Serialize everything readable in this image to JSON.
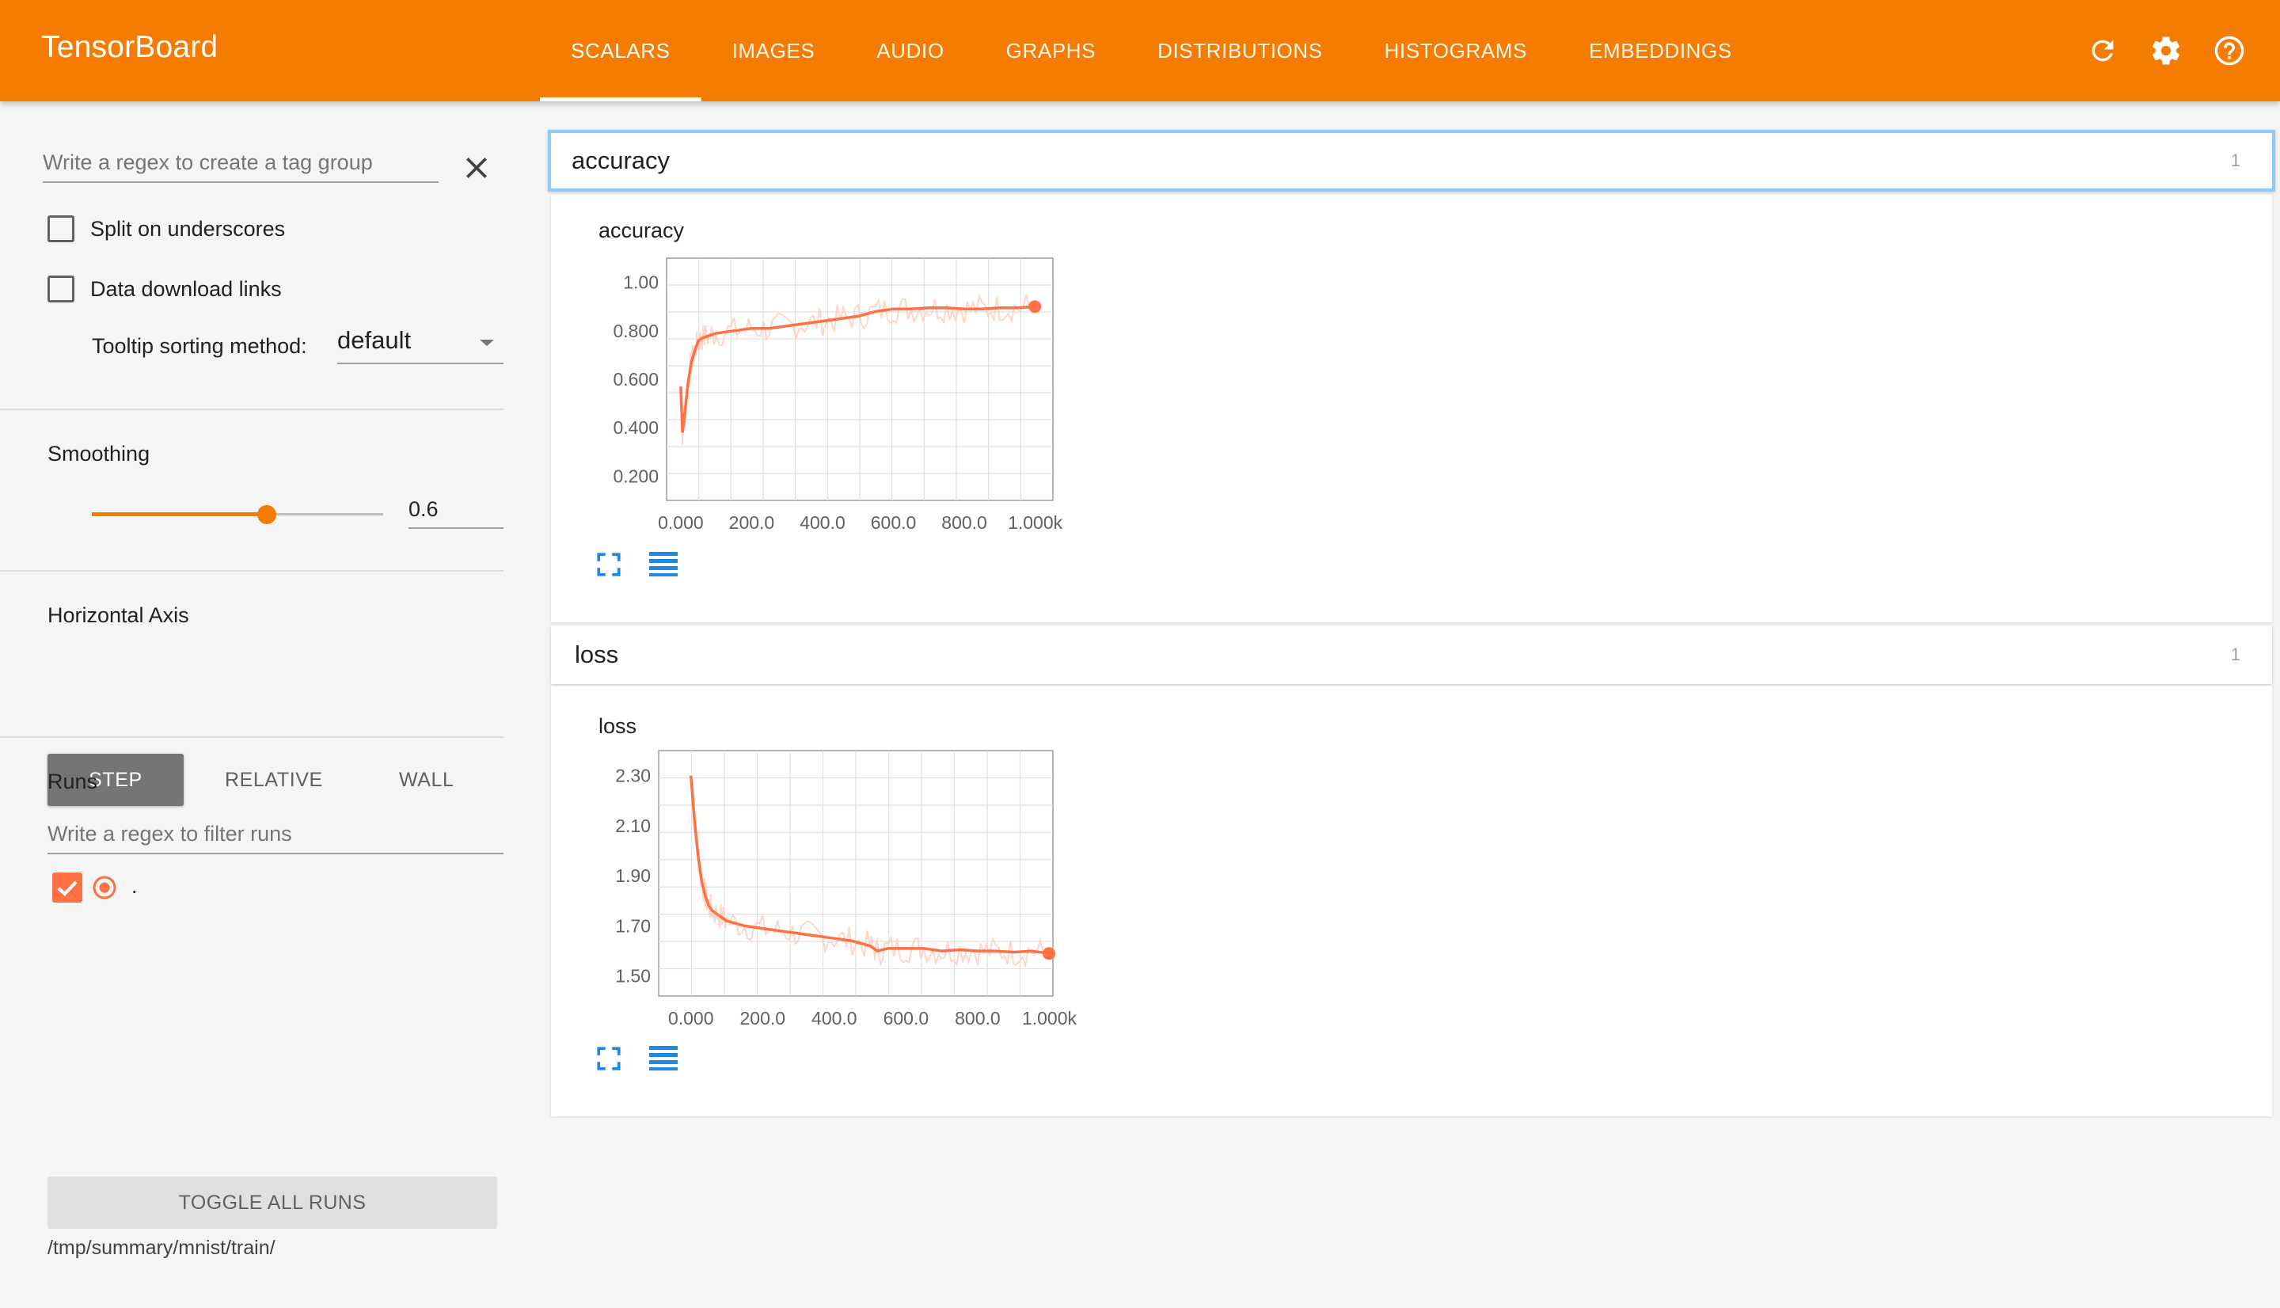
{
  "app": {
    "title": "TensorBoard"
  },
  "tabs": [
    {
      "label": "SCALARS",
      "active": true
    },
    {
      "label": "IMAGES",
      "active": false
    },
    {
      "label": "AUDIO",
      "active": false
    },
    {
      "label": "GRAPHS",
      "active": false
    },
    {
      "label": "DISTRIBUTIONS",
      "active": false
    },
    {
      "label": "HISTOGRAMS",
      "active": false
    },
    {
      "label": "EMBEDDINGS",
      "active": false
    }
  ],
  "header_icons": [
    "refresh-icon",
    "settings-gear-icon",
    "help-circle-icon"
  ],
  "sidebar": {
    "tag_regex_placeholder": "Write a regex to create a tag group",
    "split_underscores": {
      "label": "Split on underscores",
      "checked": false
    },
    "download_links": {
      "label": "Data download links",
      "checked": false
    },
    "tooltip_sort": {
      "label": "Tooltip sorting method:",
      "value": "default"
    },
    "smoothing": {
      "label": "Smoothing",
      "value": "0.6",
      "fraction": 0.6
    },
    "horizontal_axis": {
      "label": "Horizontal Axis",
      "options": [
        "STEP",
        "RELATIVE",
        "WALL"
      ],
      "selected": "STEP"
    },
    "runs": {
      "label": "Runs",
      "filter_placeholder": "Write a regex to filter runs",
      "items": [
        {
          "name": ".",
          "checked": true,
          "color": "#ff7043"
        }
      ]
    },
    "toggle_all": "TOGGLE ALL RUNS",
    "logdir": "/tmp/summary/mnist/train/"
  },
  "colors": {
    "header": "#f57c00",
    "series": "#ff7043",
    "series_raw": "#ffccbc",
    "icon_blue": "#1e88e5",
    "focus": "#90caf9"
  },
  "groups": [
    {
      "name": "accuracy",
      "count": "1"
    },
    {
      "name": "loss",
      "count": "1"
    }
  ],
  "chart_data": [
    {
      "type": "line",
      "title": "accuracy",
      "xlabel": "",
      "ylabel": "",
      "x_ticks": [
        "0.000",
        "200.0",
        "400.0",
        "600.0",
        "800.0",
        "1.000k"
      ],
      "y_ticks": [
        "1.00",
        "0.800",
        "0.600",
        "0.400",
        "0.200"
      ],
      "xlim": [
        -40,
        1050
      ],
      "ylim": [
        0.1,
        1.1
      ],
      "grid": true,
      "legend": "none",
      "series": [
        {
          "x": [
            0,
            5,
            10,
            20,
            30,
            40,
            50,
            60,
            80,
            100,
            150,
            200,
            250,
            300,
            350,
            400,
            450,
            500,
            550,
            600,
            650,
            700,
            750,
            800,
            850,
            900,
            950,
            999
          ],
          "y": [
            0.57,
            0.38,
            0.44,
            0.58,
            0.67,
            0.72,
            0.76,
            0.77,
            0.78,
            0.79,
            0.8,
            0.81,
            0.81,
            0.82,
            0.83,
            0.84,
            0.85,
            0.86,
            0.88,
            0.89,
            0.89,
            0.895,
            0.895,
            0.89,
            0.89,
            0.895,
            0.895,
            0.9
          ]
        }
      ]
    },
    {
      "type": "line",
      "title": "loss",
      "xlabel": "",
      "ylabel": "",
      "x_ticks": [
        "0.000",
        "200.0",
        "400.0",
        "600.0",
        "800.0",
        "1.000k"
      ],
      "y_ticks": [
        "2.30",
        "2.10",
        "1.90",
        "1.70",
        "1.50"
      ],
      "xlim": [
        -90,
        1010
      ],
      "ylim": [
        1.42,
        2.4
      ],
      "grid": true,
      "legend": "none",
      "series": [
        {
          "x": [
            0,
            10,
            20,
            30,
            40,
            50,
            60,
            80,
            100,
            150,
            200,
            250,
            300,
            350,
            400,
            450,
            500,
            520,
            550,
            600,
            650,
            700,
            750,
            800,
            850,
            900,
            950,
            999
          ],
          "y": [
            2.3,
            2.12,
            1.98,
            1.88,
            1.82,
            1.78,
            1.76,
            1.74,
            1.72,
            1.7,
            1.69,
            1.68,
            1.67,
            1.66,
            1.65,
            1.64,
            1.62,
            1.6,
            1.61,
            1.61,
            1.61,
            1.6,
            1.605,
            1.6,
            1.6,
            1.595,
            1.6,
            1.59
          ]
        }
      ]
    }
  ]
}
